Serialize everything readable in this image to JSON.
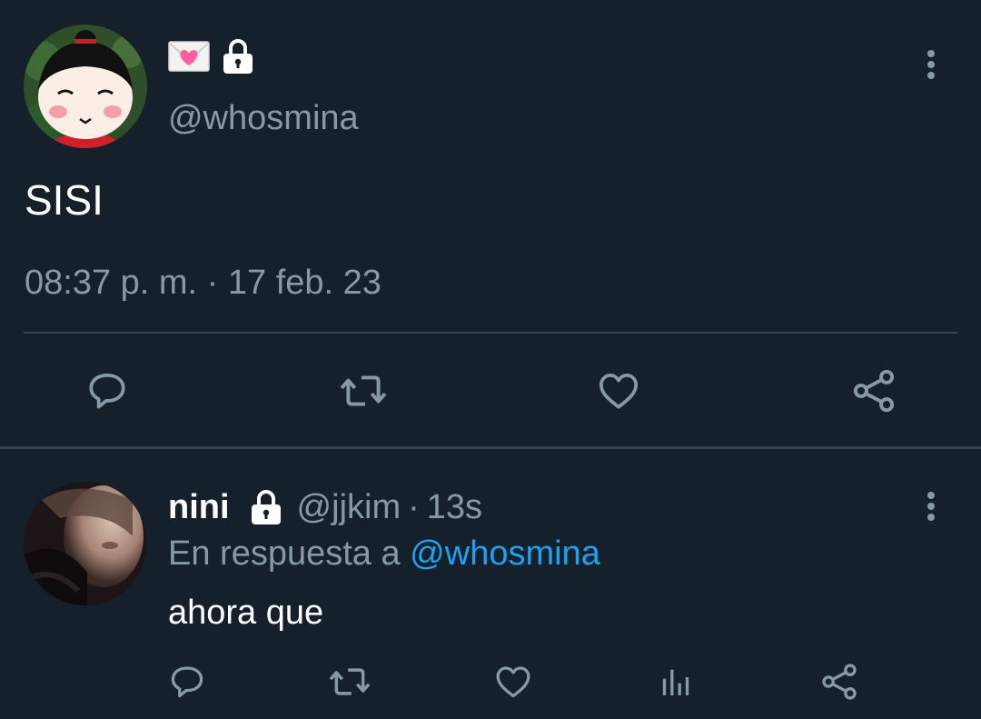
{
  "theme": {
    "background": "#15202b",
    "text_primary": "#ffffff",
    "text_secondary": "#8899a6",
    "divider": "#38444d",
    "accent": "#1da1f2",
    "heart_emoji": "#ff5fa2"
  },
  "main_tweet": {
    "display_name_icons": [
      "love-letter-icon",
      "lock-icon"
    ],
    "handle": "@whosmina",
    "text": "SISI",
    "timestamp": "08:37 p. m. · 17 feb. 23",
    "actions": [
      "reply-icon",
      "retweet-icon",
      "like-icon",
      "share-icon"
    ],
    "more_icon": "more-vertical-icon"
  },
  "reply_tweet": {
    "display_name": "nini",
    "locked_icon": "lock-icon",
    "handle": "@jjkim",
    "separator": "·",
    "time_ago": "13s",
    "replying_to_prefix": "En respuesta a",
    "replying_to_handle": "@whosmina",
    "text": "ahora que",
    "actions": [
      "reply-icon",
      "retweet-icon",
      "like-icon",
      "analytics-icon",
      "share-icon"
    ],
    "more_icon": "more-vertical-icon"
  }
}
